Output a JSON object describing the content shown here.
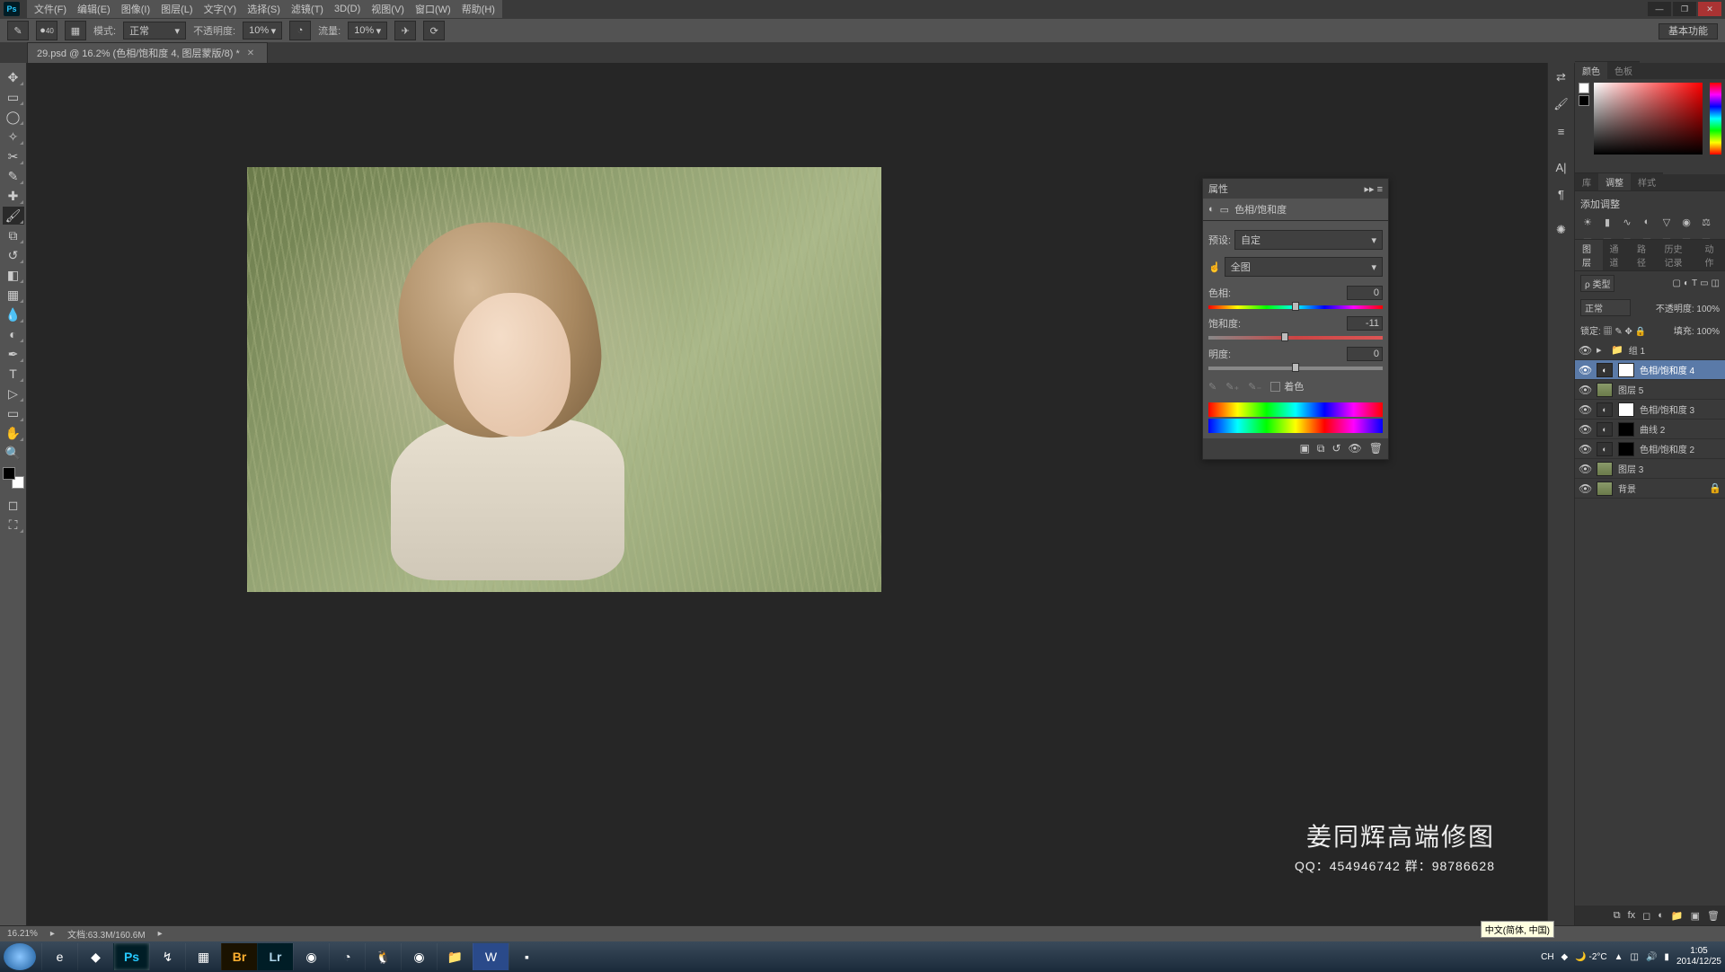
{
  "menubar": [
    "文件(F)",
    "编辑(E)",
    "图像(I)",
    "图层(L)",
    "文字(Y)",
    "选择(S)",
    "滤镜(T)",
    "3D(D)",
    "视图(V)",
    "窗口(W)",
    "帮助(H)"
  ],
  "workspace_tab": "基本功能",
  "optbar": {
    "brush_size": "40",
    "mode_label": "模式:",
    "mode_value": "正常",
    "opacity_label": "不透明度:",
    "opacity_value": "10%",
    "flow_label": "流量:",
    "flow_value": "10%"
  },
  "doc_tab": "29.psd @ 16.2% (色相/饱和度 4, 图层蒙版/8) *",
  "watermark": {
    "title": "姜同辉高端修图",
    "sub": "QQ：454946742   群：98786628"
  },
  "statusbar": {
    "zoom": "16.21%",
    "doc": "文档:63.3M/160.6M"
  },
  "properties": {
    "panel_title": "属性",
    "title": "色相/饱和度",
    "preset_label": "预设:",
    "preset_value": "自定",
    "target_value": "全图",
    "hue_label": "色相:",
    "hue_value": "0",
    "sat_label": "饱和度:",
    "sat_value": "-11",
    "light_label": "明度:",
    "light_value": "0",
    "colorize": "着色"
  },
  "color_tabs": [
    "颜色",
    "色板"
  ],
  "adj_tabs": [
    "库",
    "调整",
    "样式"
  ],
  "adjust_title": "添加调整",
  "layer_tabs": [
    "图层",
    "通道",
    "路径",
    "历史记录",
    "动作"
  ],
  "layers_panel": {
    "kind": "ρ 类型",
    "blend": "正常",
    "opacity_label": "不透明度:",
    "opacity_value": "100%",
    "lock_label": "锁定:",
    "fill_label": "填充:",
    "fill_value": "100%"
  },
  "layers": [
    {
      "type": "group",
      "name": "组 1"
    },
    {
      "type": "adj",
      "name": "色相/饱和度 4",
      "selected": true,
      "mask": true
    },
    {
      "type": "img",
      "name": "图层 5"
    },
    {
      "type": "adj",
      "name": "色相/饱和度 3",
      "mask": true
    },
    {
      "type": "adj",
      "name": "曲线 2",
      "mask": true,
      "dark": true
    },
    {
      "type": "adj",
      "name": "色相/饱和度 2",
      "mask": true,
      "dark": true
    },
    {
      "type": "img",
      "name": "图层 3"
    },
    {
      "type": "img",
      "name": "背景",
      "locked": true
    }
  ],
  "ime": "中文(简体, 中国)",
  "tray": {
    "temp": "-2°C",
    "time": "1:05",
    "date": "2014/12/25"
  }
}
